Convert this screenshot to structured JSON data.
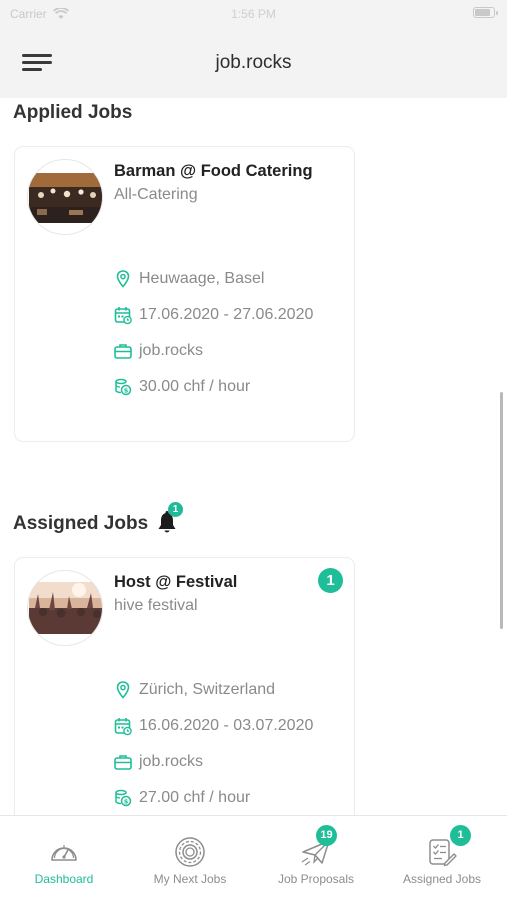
{
  "app": {
    "title": "job.rocks"
  },
  "status_bar": {
    "carrier": "Carrier",
    "time": "1:56 PM"
  },
  "sections": {
    "applied_title": "Applied Jobs",
    "assigned_title": "Assigned Jobs",
    "assigned_notification_count": "1"
  },
  "applied_jobs": [
    {
      "title": "Barman @ Food Catering",
      "company": "All-Catering",
      "location": "Heuwaage, Basel",
      "dates": "17.06.2020 - 27.06.2020",
      "agency": "job.rocks",
      "rate": "30.00 chf / hour",
      "image": "catering-photo"
    }
  ],
  "assigned_jobs": [
    {
      "title": "Host @ Festival",
      "company": "hive festival",
      "location": "Zürich, Switzerland",
      "dates": "16.06.2020 - 03.07.2020",
      "agency": "job.rocks",
      "rate": "27.00 chf / hour",
      "badge": "1",
      "image": "festival-photo"
    }
  ],
  "tabs": [
    {
      "label": "Dashboard",
      "icon": "speedometer-icon",
      "active": true
    },
    {
      "label": "My Next Jobs",
      "icon": "target-icon"
    },
    {
      "label": "Job Proposals",
      "icon": "paper-plane-icon",
      "badge": "19"
    },
    {
      "label": "Assigned Jobs",
      "icon": "checklist-icon",
      "badge": "1"
    }
  ],
  "colors": {
    "accent": "#1fbe99",
    "header_bg": "#f3f3f3",
    "text_muted": "#8a8a8a"
  }
}
